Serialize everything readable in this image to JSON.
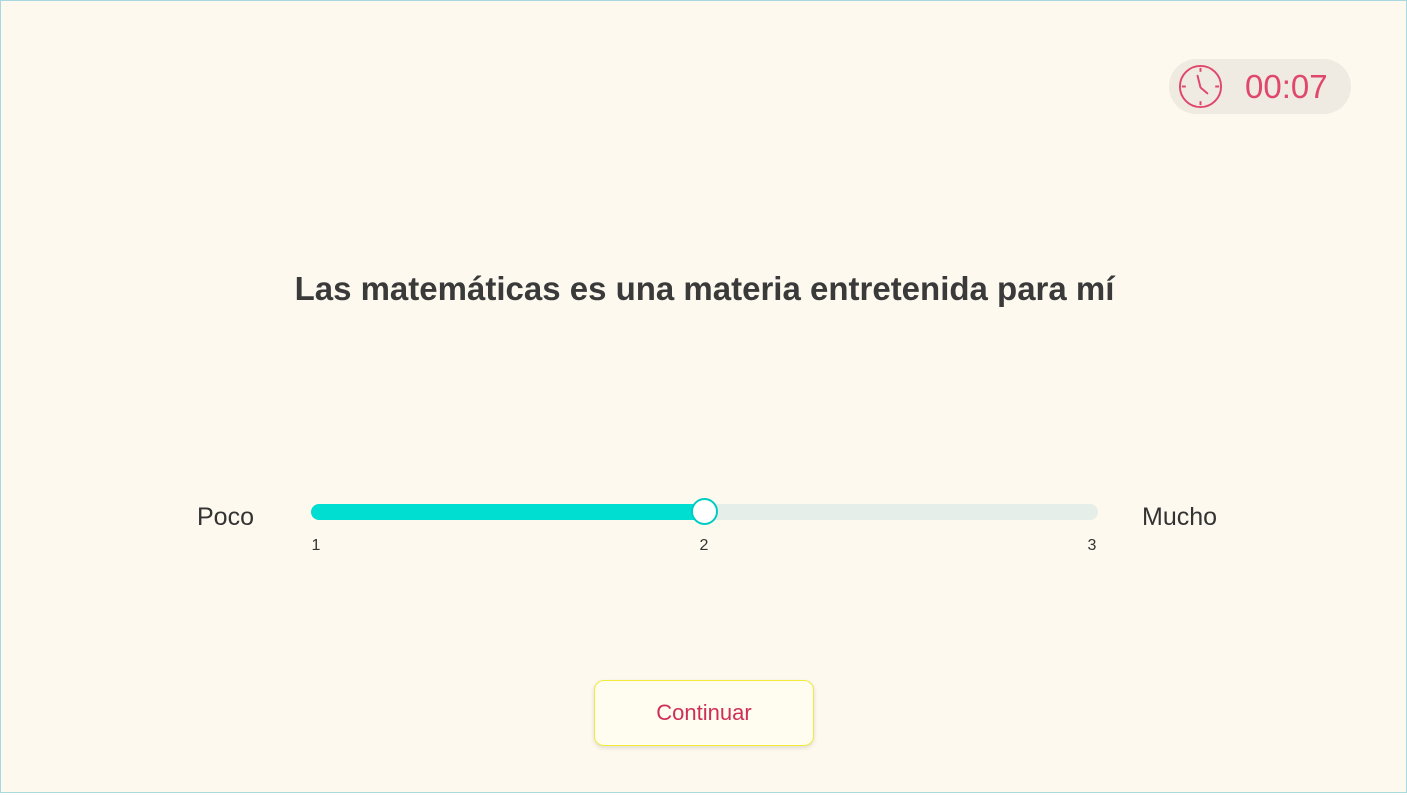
{
  "timer": {
    "icon": "clock-icon",
    "value": "00:07",
    "color": "#e0476c"
  },
  "question": {
    "text": "Las matemáticas es una materia entretenida para mí"
  },
  "scale": {
    "min_label": "Poco",
    "max_label": "Mucho",
    "ticks": [
      "1",
      "2",
      "3"
    ],
    "min": 1,
    "max": 3,
    "value": 2,
    "accent_color": "#00ded2"
  },
  "actions": {
    "continue_label": "Continuar"
  }
}
